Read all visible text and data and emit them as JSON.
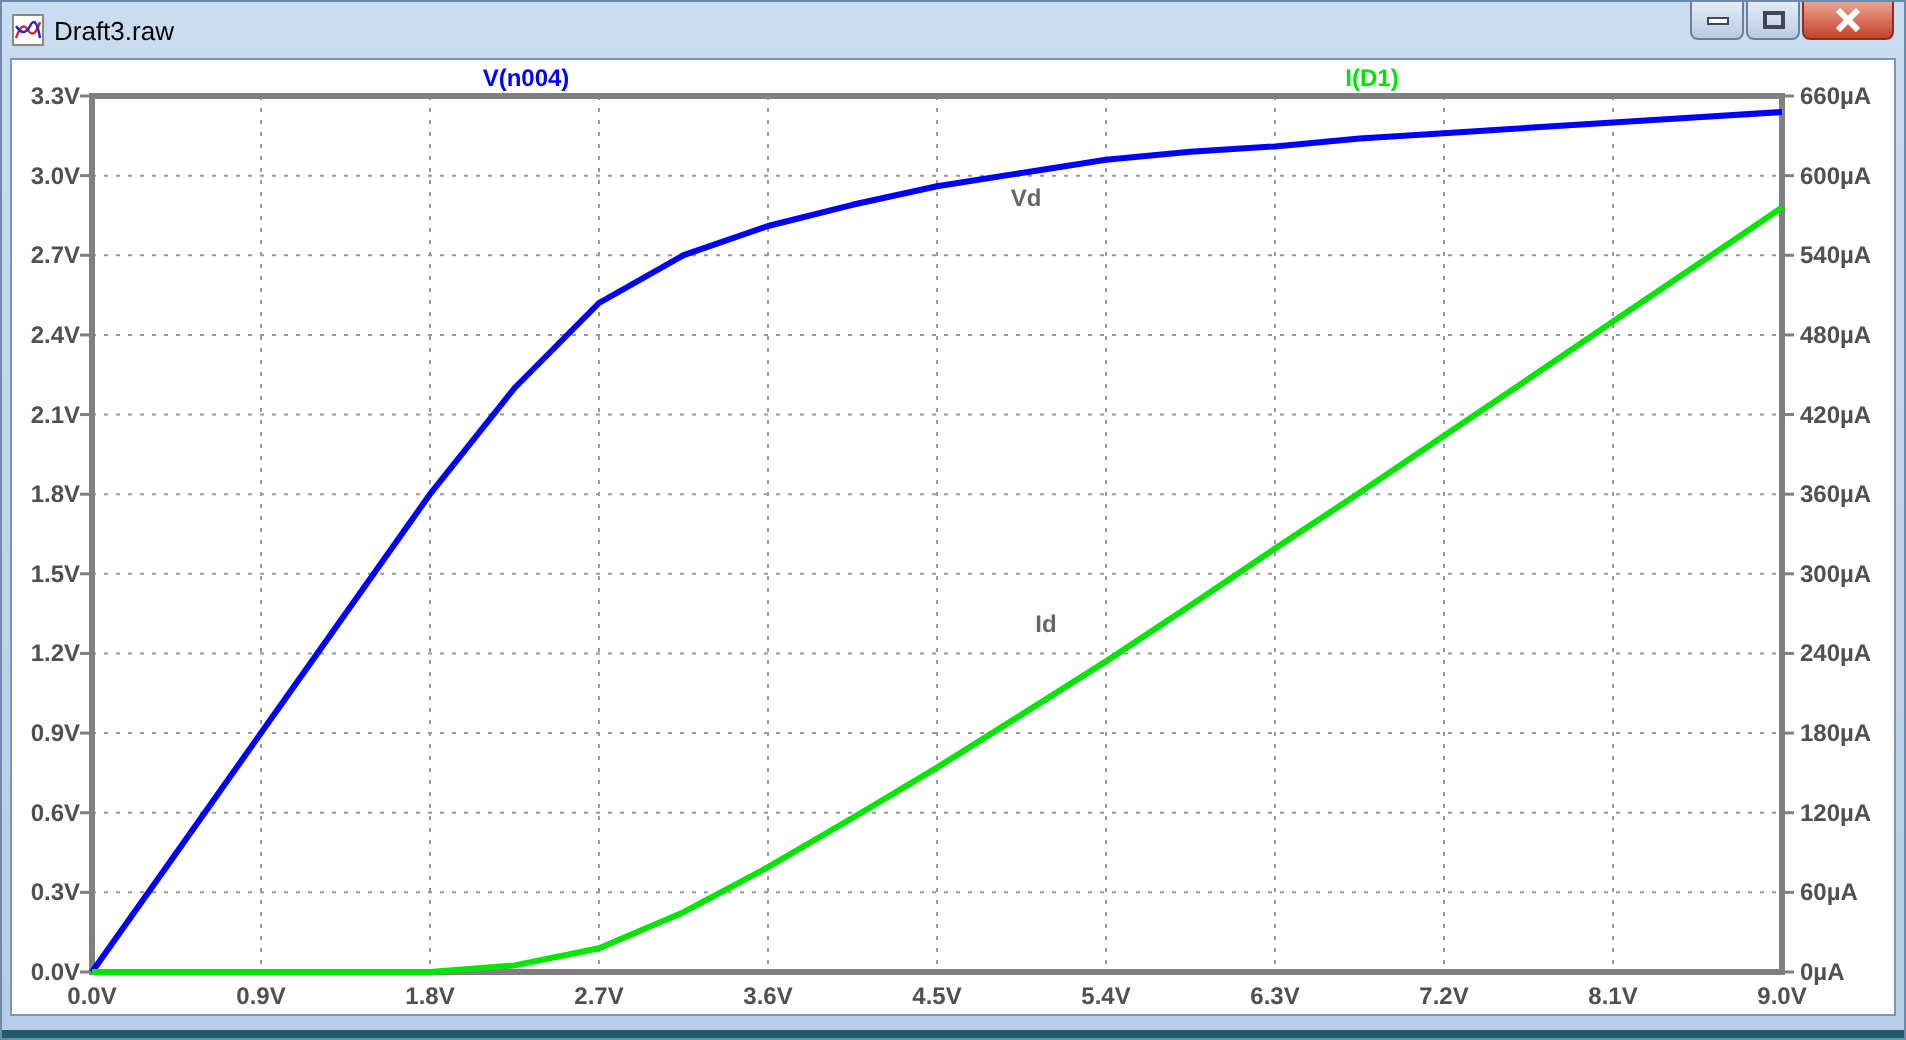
{
  "window": {
    "title": "Draft3.raw"
  },
  "plot": {
    "chart_data": {
      "type": "line",
      "x": [
        0,
        0.45,
        0.9,
        1.35,
        1.8,
        2.25,
        2.7,
        3.15,
        3.6,
        4.05,
        4.5,
        4.95,
        5.4,
        5.85,
        6.3,
        6.75,
        7.2,
        7.65,
        8.1,
        8.55,
        9
      ],
      "series": [
        {
          "name": "V(n004)",
          "color": "#0000ff",
          "values": [
            0,
            0.45,
            0.9,
            1.35,
            1.8,
            2.2,
            2.52,
            2.7,
            2.81,
            2.89,
            2.96,
            3.01,
            3.06,
            3.09,
            3.11,
            3.14,
            3.16,
            3.18,
            3.2,
            3.22,
            3.24
          ]
        },
        {
          "name": "I(D1)",
          "color": "#00e600",
          "axis": "y2",
          "values": [
            0,
            0,
            0,
            0,
            0,
            5,
            18,
            45,
            79,
            116,
            154,
            194,
            234,
            276,
            319,
            361,
            404,
            447,
            490,
            533,
            576
          ]
        }
      ],
      "xlim": [
        0,
        9
      ],
      "ylim": [
        0,
        3.3
      ],
      "y2lim": [
        0,
        660
      ],
      "xticks": [
        {
          "value": 0,
          "label": "0.0V"
        },
        {
          "value": 0.9,
          "label": "0.9V"
        },
        {
          "value": 1.8,
          "label": "1.8V"
        },
        {
          "value": 2.7,
          "label": "2.7V"
        },
        {
          "value": 3.6,
          "label": "3.6V"
        },
        {
          "value": 4.5,
          "label": "4.5V"
        },
        {
          "value": 5.4,
          "label": "5.4V"
        },
        {
          "value": 6.3,
          "label": "6.3V"
        },
        {
          "value": 7.2,
          "label": "7.2V"
        },
        {
          "value": 8.1,
          "label": "8.1V"
        },
        {
          "value": 9,
          "label": "9.0V"
        }
      ],
      "yticks": [
        {
          "value": 0,
          "label": "0.0V"
        },
        {
          "value": 0.3,
          "label": "0.3V"
        },
        {
          "value": 0.6,
          "label": "0.6V"
        },
        {
          "value": 0.9,
          "label": "0.9V"
        },
        {
          "value": 1.2,
          "label": "1.2V"
        },
        {
          "value": 1.5,
          "label": "1.5V"
        },
        {
          "value": 1.8,
          "label": "1.8V"
        },
        {
          "value": 2.1,
          "label": "2.1V"
        },
        {
          "value": 2.4,
          "label": "2.4V"
        },
        {
          "value": 2.7,
          "label": "2.7V"
        },
        {
          "value": 3.0,
          "label": "3.0V"
        },
        {
          "value": 3.3,
          "label": "3.3V"
        }
      ],
      "y2ticks": [
        {
          "value": 0,
          "label": "0µA"
        },
        {
          "value": 60,
          "label": "60µA"
        },
        {
          "value": 120,
          "label": "120µA"
        },
        {
          "value": 180,
          "label": "180µA"
        },
        {
          "value": 240,
          "label": "240µA"
        },
        {
          "value": 300,
          "label": "300µA"
        },
        {
          "value": 360,
          "label": "360µA"
        },
        {
          "value": 420,
          "label": "420µA"
        },
        {
          "value": 480,
          "label": "480µA"
        },
        {
          "value": 540,
          "label": "540µA"
        },
        {
          "value": 600,
          "label": "600µA"
        },
        {
          "value": 660,
          "label": "660µA"
        }
      ],
      "annotations": [
        "Vd",
        "Id"
      ],
      "grid": true
    }
  }
}
